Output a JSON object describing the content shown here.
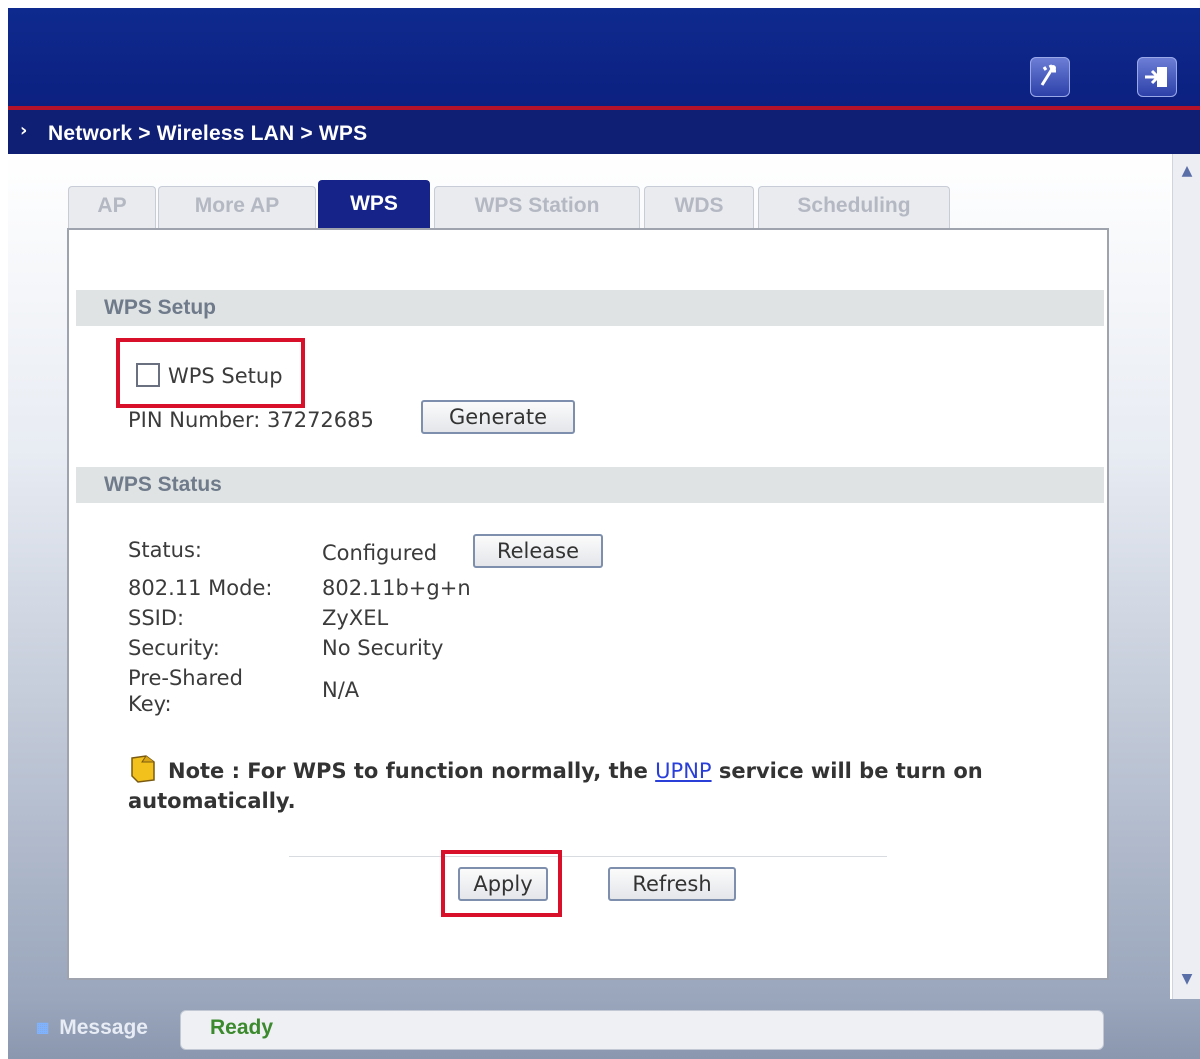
{
  "breadcrumb": "Network > Wireless LAN > WPS",
  "header": {
    "icons": [
      "wizard-icon",
      "logout-icon"
    ]
  },
  "tabs": [
    {
      "label": "AP",
      "active": false
    },
    {
      "label": "More AP",
      "active": false
    },
    {
      "label": "WPS",
      "active": true
    },
    {
      "label": "WPS Station",
      "active": false
    },
    {
      "label": "WDS",
      "active": false
    },
    {
      "label": "Scheduling",
      "active": false
    }
  ],
  "wps_setup": {
    "section_title": "WPS Setup",
    "checkbox_label": "WPS Setup",
    "checked": false,
    "pin_label": "PIN Number: 37272685",
    "generate_label": "Generate"
  },
  "wps_status": {
    "section_title": "WPS Status",
    "status_label": "Status:",
    "status_value": "Configured",
    "release_label": "Release",
    "mode_label": "802.11 Mode:",
    "mode_value": "802.11b+g+n",
    "ssid_label": "SSID:",
    "ssid_value": "ZyXEL",
    "security_label": "Security:",
    "security_value": "No Security",
    "psk_label_line1": "Pre-Shared",
    "psk_label_line2": "Key:",
    "psk_value": "N/A"
  },
  "note": {
    "prefix": "Note : For WPS to function normally, the ",
    "link": "UPNP",
    "suffix": " service will be turn on automatically."
  },
  "actions": {
    "apply_label": "Apply",
    "refresh_label": "Refresh"
  },
  "statusbar": {
    "label": "Message",
    "value": "Ready"
  },
  "colors": {
    "header": "#0e2a8e",
    "active_tab": "#16248a",
    "highlight": "#d9102a",
    "ready": "#3c8a2e"
  }
}
